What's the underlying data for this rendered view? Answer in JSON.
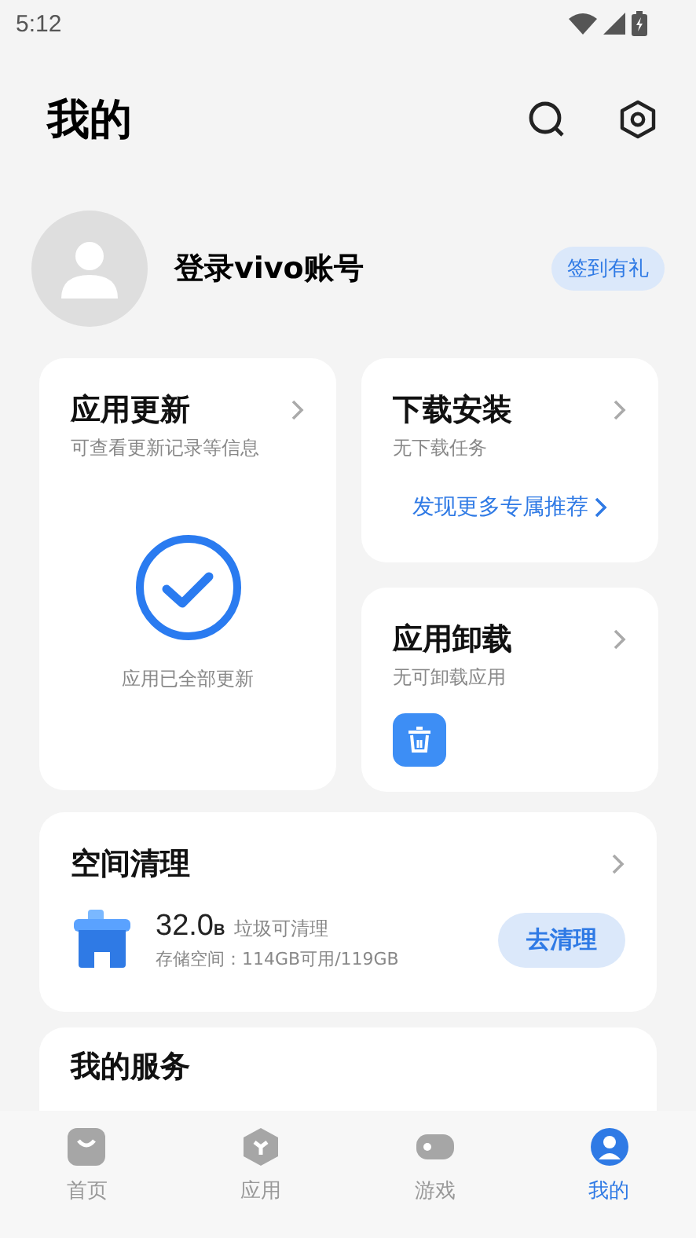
{
  "status_bar": {
    "time": "5:12"
  },
  "header": {
    "title": "我的"
  },
  "profile": {
    "login": "登录vivo账号",
    "badge": "签到有礼"
  },
  "update_card": {
    "title": "应用更新",
    "subtitle": "可查看更新记录等信息",
    "status": "应用已全部更新"
  },
  "download_card": {
    "title": "下载安装",
    "subtitle": "无下载任务",
    "link": "发现更多专属推荐"
  },
  "uninstall_card": {
    "title": "应用卸载",
    "subtitle": "无可卸载应用"
  },
  "clean_card": {
    "title": "空间清理",
    "amount": "32.0",
    "unit": "B",
    "amount_label": "垃圾可清理",
    "storage": "存储空间：114GB可用/119GB",
    "button": "去清理"
  },
  "service_card": {
    "title": "我的服务"
  },
  "bottom_nav": [
    {
      "label": "首页",
      "kind": "home",
      "selected": false
    },
    {
      "label": "应用",
      "kind": "apps",
      "selected": false
    },
    {
      "label": "游戏",
      "kind": "games",
      "selected": false
    },
    {
      "label": "我的",
      "kind": "me",
      "selected": true
    }
  ]
}
